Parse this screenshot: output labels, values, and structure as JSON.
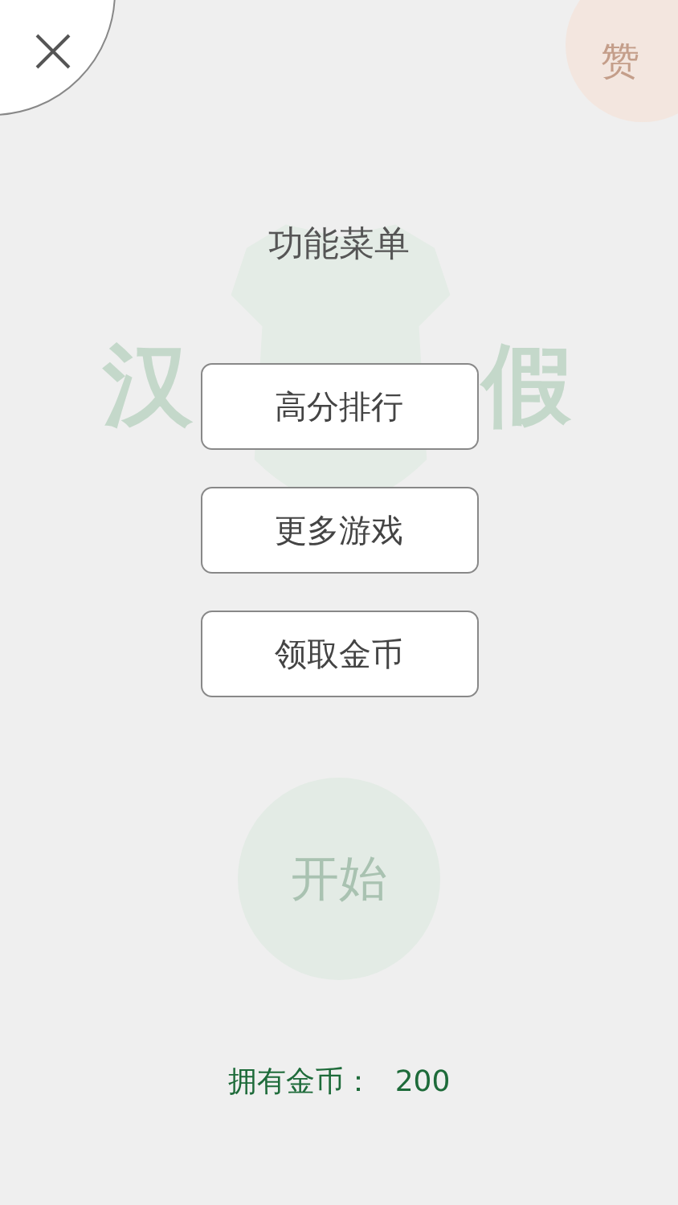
{
  "background": {
    "logo_left": "汉",
    "logo_right": "假",
    "like_button": "赞",
    "start_button": "开始"
  },
  "menu": {
    "title": "功能菜单",
    "items": [
      {
        "label": "高分排行"
      },
      {
        "label": "更多游戏"
      },
      {
        "label": "领取金币"
      }
    ]
  },
  "coins": {
    "label": "拥有金币：",
    "value": "200"
  }
}
